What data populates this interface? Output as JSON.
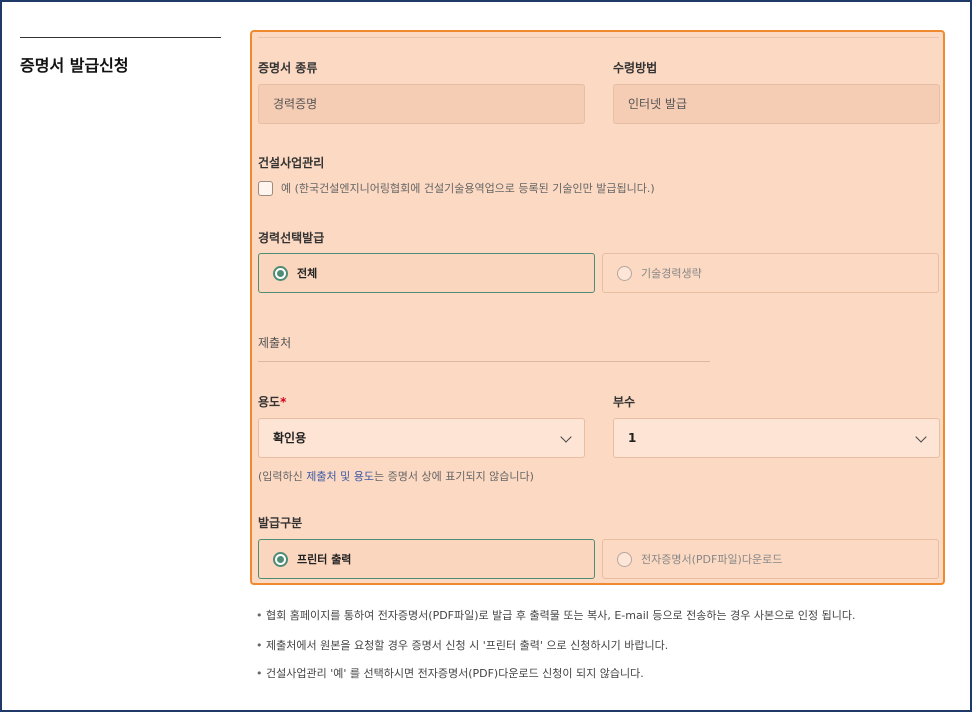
{
  "sidebar": {
    "title": "증명서 발급신청"
  },
  "form": {
    "cert_type": {
      "label": "증명서 종류",
      "value": "경력증명"
    },
    "receive_method": {
      "label": "수령방법",
      "value": "인터넷 발급"
    },
    "construction_mgmt": {
      "label": "건설사업관리",
      "checkbox_text": "예 (한국건설엔지니어링협회에 건설기술용역업으로 등록된 기술인만 발급됩니다.)",
      "checked": false
    },
    "career_select": {
      "label": "경력선택발급",
      "options": [
        {
          "label": "전체",
          "selected": true
        },
        {
          "label": "기술경력생략",
          "selected": false
        }
      ]
    },
    "submit_to": {
      "placeholder": "제출처"
    },
    "purpose": {
      "label": "용도",
      "required_mark": "*",
      "value": "확인용"
    },
    "copies": {
      "label": "부수",
      "value": "1"
    },
    "hint": {
      "prefix": "(입력하신 ",
      "highlight": "제출처 및 용도",
      "suffix": "는 증명서 상에 표기되지 않습니다)"
    },
    "issue_type": {
      "label": "발급구분",
      "options": [
        {
          "label": "프린터 출력",
          "selected": true
        },
        {
          "label": "전자증명서(PDF파일)다운로드",
          "selected": false
        }
      ]
    }
  },
  "notes": [
    "협회 홈페이지를 통하여 전자증명서(PDF파일)로 발급 후 출력물 또는 복사, E-mail 등으로 전송하는 경우 사본으로 인정 됩니다.",
    "제출처에서 원본을 요청할 경우 증명서 신청 시 '프린터 출력' 으로 신청하시기 바랍니다.",
    "건설사업관리 '예' 를 선택하시면 전자증명서(PDF)다운로드 신청이 되지 않습니다."
  ],
  "colors": {
    "panel_border": "#f08a2e",
    "panel_bg": "#fcd9c2",
    "accent_green": "#4f8c75",
    "highlight_blue": "#3b5aa8",
    "frame": "#1f3a68"
  }
}
